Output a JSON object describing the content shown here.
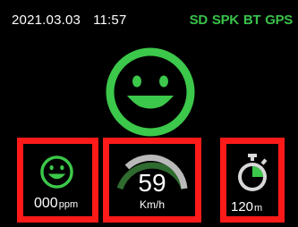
{
  "status": {
    "date": "2021.03.03",
    "time": "11:57",
    "indicators": [
      {
        "label": "SD",
        "color": "#39c24a"
      },
      {
        "label": "SPK",
        "color": "#39c24a"
      },
      {
        "label": "BT",
        "color": "#39c24a"
      },
      {
        "label": "GPS",
        "color": "#39c24a"
      }
    ]
  },
  "main_face": {
    "icon": "smiley-face-icon",
    "color": "#3cc84a"
  },
  "air_panel": {
    "icon": "smiley-face-icon",
    "value": "000",
    "unit": "ppm",
    "border_color": "#ff1a1a"
  },
  "speed_panel": {
    "value": "59",
    "unit": "Km/h",
    "gauge_fraction": 0.85,
    "gauge_color": "#b9b9b9",
    "gauge_accent": "#3a7a3a"
  },
  "timer_panel": {
    "icon": "stopwatch-icon",
    "value": "120",
    "unit": "m",
    "accent_color": "#3cc84a"
  }
}
